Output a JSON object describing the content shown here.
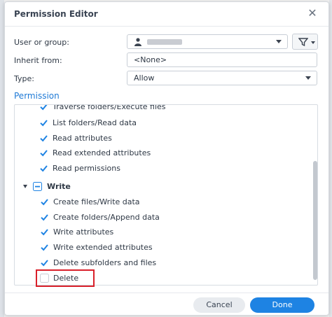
{
  "dialog": {
    "title": "Permission Editor",
    "close_icon": "close-icon"
  },
  "form": {
    "user_label": "User or group:",
    "user_value": "",
    "inherit_label": "Inherit from:",
    "inherit_value": "<None>",
    "type_label": "Type:",
    "type_value": "Allow"
  },
  "permission": {
    "section_title": "Permission",
    "read_items": [
      {
        "label": "Traverse folders/Execute files",
        "checked": true
      },
      {
        "label": "List folders/Read data",
        "checked": true
      },
      {
        "label": "Read attributes",
        "checked": true
      },
      {
        "label": "Read extended attributes",
        "checked": true
      },
      {
        "label": "Read permissions",
        "checked": true
      }
    ],
    "write_group": {
      "label": "Write",
      "state": "partial"
    },
    "write_items": [
      {
        "label": "Create files/Write data",
        "checked": true
      },
      {
        "label": "Create folders/Append data",
        "checked": true
      },
      {
        "label": "Write attributes",
        "checked": true
      },
      {
        "label": "Write extended attributes",
        "checked": true
      },
      {
        "label": "Delete subfolders and files",
        "checked": true
      },
      {
        "label": "Delete",
        "checked": false
      }
    ]
  },
  "footer": {
    "cancel_label": "Cancel",
    "done_label": "Done"
  },
  "colors": {
    "accent": "#1e83e3",
    "highlight": "#d9202a"
  }
}
